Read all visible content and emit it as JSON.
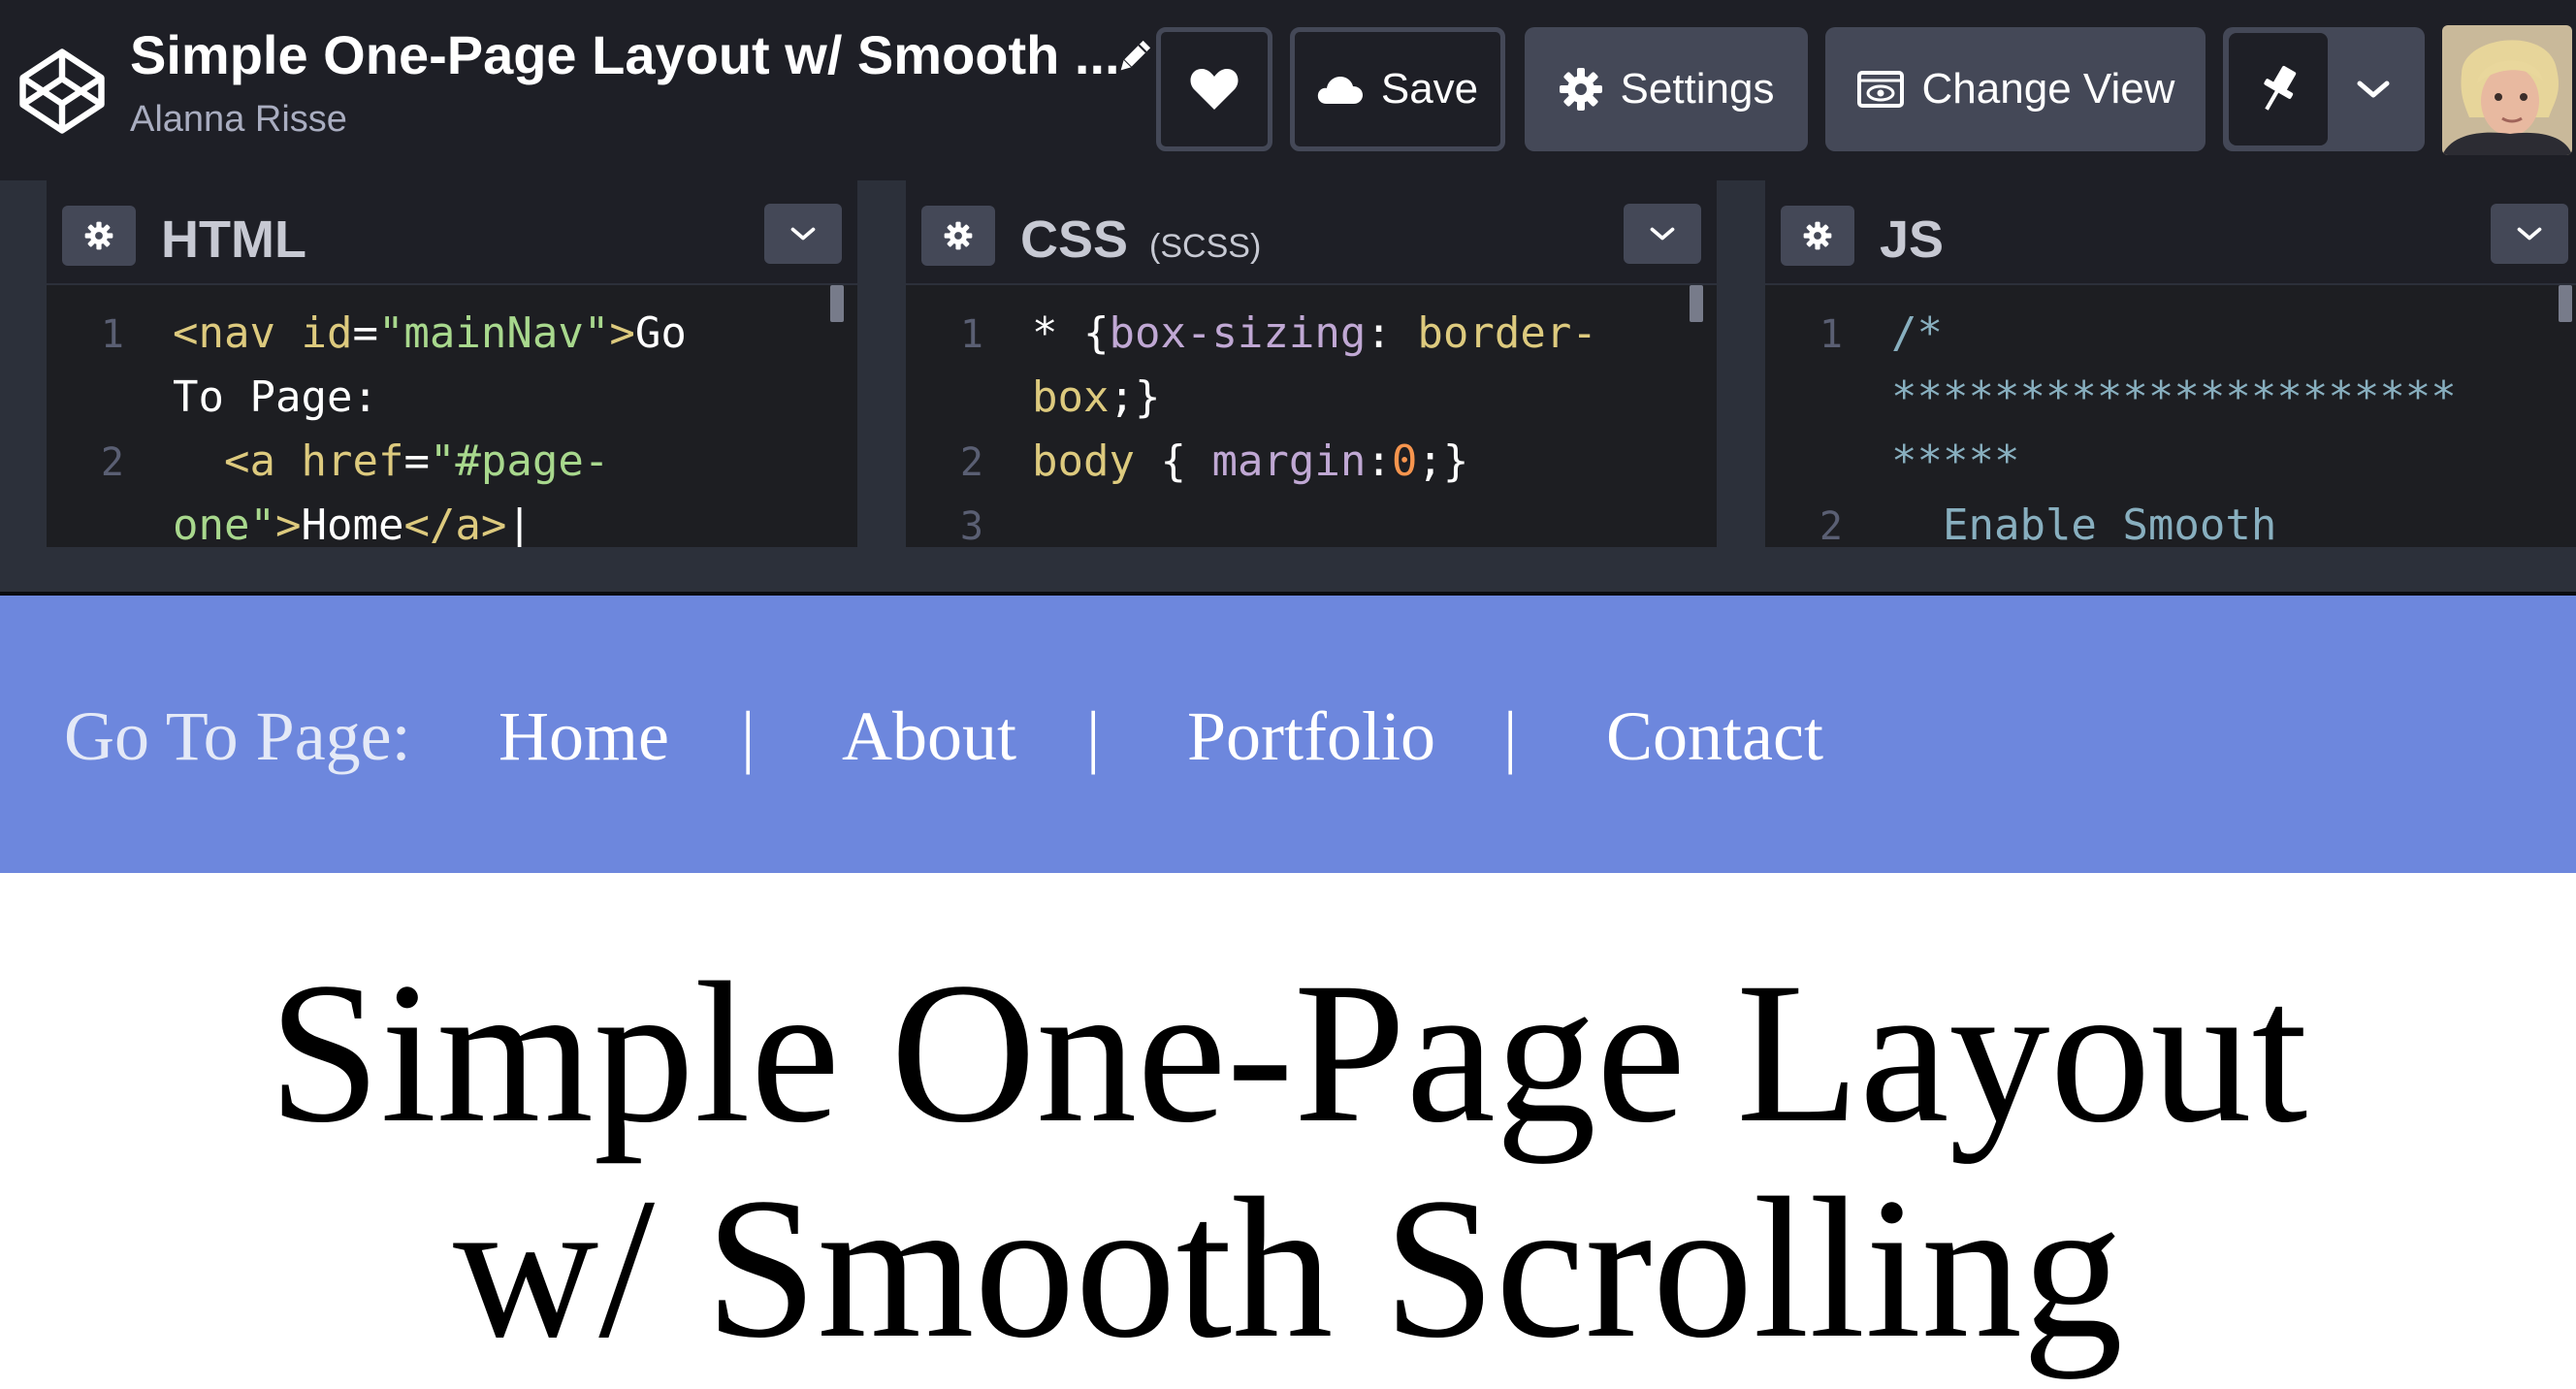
{
  "header": {
    "pen_title": "Simple One-Page Layout w/ Smooth ...",
    "author": "Alanna Risse",
    "buttons": {
      "save_label": "Save",
      "settings_label": "Settings",
      "change_view_label": "Change View"
    },
    "icons": [
      "codepen-logo-icon",
      "pencil-icon",
      "heart-icon",
      "cloud-icon",
      "gear-icon",
      "eye-window-icon",
      "pin-icon",
      "chevron-down-icon"
    ]
  },
  "editors": [
    {
      "title": "HTML",
      "subtitle": "",
      "lines": [
        {
          "num": "1",
          "parts": [
            [
              "t",
              "<nav "
            ],
            [
              "a",
              "id"
            ],
            [
              "pl",
              "="
            ],
            [
              "s",
              "\"mainNav\""
            ],
            [
              "t",
              ">"
            ],
            [
              "pl",
              "Go"
            ]
          ]
        },
        {
          "num": "",
          "parts": [
            [
              "pl",
              "To Page:"
            ]
          ]
        },
        {
          "num": "2",
          "parts": [
            [
              "pl",
              "  "
            ],
            [
              "t",
              "<a "
            ],
            [
              "a",
              "href"
            ],
            [
              "pl",
              "="
            ],
            [
              "s",
              "\"#page-"
            ]
          ]
        },
        {
          "num": "",
          "parts": [
            [
              "s",
              "one\""
            ],
            [
              "t",
              ">"
            ],
            [
              "pl",
              "Home"
            ],
            [
              "t",
              "</a>"
            ],
            [
              "pl",
              "|"
            ]
          ]
        }
      ]
    },
    {
      "title": "CSS",
      "subtitle": "(SCSS)",
      "lines": [
        {
          "num": "1",
          "parts": [
            [
              "pl",
              "* {"
            ],
            [
              "pr",
              "box-sizing"
            ],
            [
              "pl",
              ": "
            ],
            [
              "v",
              "border-"
            ]
          ]
        },
        {
          "num": "",
          "parts": [
            [
              "v",
              "box"
            ],
            [
              "pl",
              ";}"
            ]
          ]
        },
        {
          "num": "2",
          "parts": [
            [
              "sel",
              "body"
            ],
            [
              "pl",
              " { "
            ],
            [
              "pr",
              "margin"
            ],
            [
              "pl",
              ":"
            ],
            [
              "num",
              "0"
            ],
            [
              "pl",
              ";}"
            ]
          ]
        },
        {
          "num": "3",
          "parts": []
        }
      ]
    },
    {
      "title": "JS",
      "subtitle": "",
      "lines": [
        {
          "num": "1",
          "parts": [
            [
              "cm",
              "/*"
            ]
          ]
        },
        {
          "num": "",
          "parts": [
            [
              "cm",
              "**********************"
            ]
          ]
        },
        {
          "num": "",
          "parts": [
            [
              "cm",
              "*****"
            ]
          ]
        },
        {
          "num": "2",
          "parts": [
            [
              "cm",
              "  Enable Smooth"
            ]
          ]
        }
      ]
    }
  ],
  "preview": {
    "nav": {
      "label": "Go To Page:",
      "links": [
        "Home",
        "About",
        "Portfolio",
        "Contact"
      ],
      "separator": "|"
    },
    "heading_line1": "Simple One-Page Layout",
    "heading_line2": "w/ Smooth Scrolling"
  },
  "colors": {
    "header_bg": "#1e1f26",
    "button_bg": "#444857",
    "editor_bg": "#1d1e22",
    "nav_bg": "#6d87dd"
  }
}
